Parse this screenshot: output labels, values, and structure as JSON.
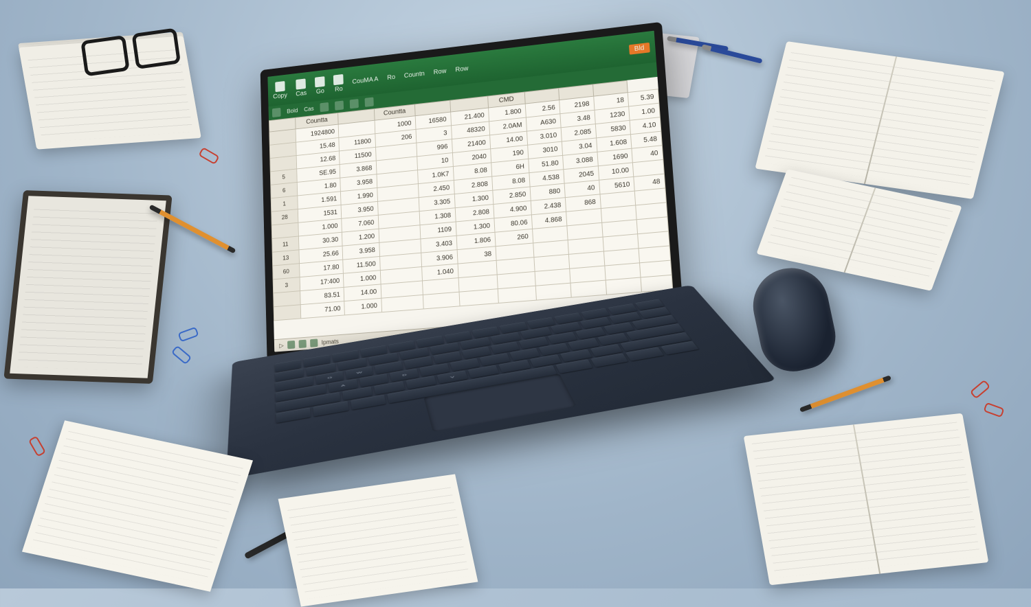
{
  "ribbon": {
    "items": [
      "Copy",
      "Cas",
      "Go",
      "Ro",
      "CouMA A",
      "Ro",
      "Countn",
      "Row",
      "Row"
    ],
    "right_badge": "Bld"
  },
  "toolbar": {
    "items": [
      "Bold",
      "Cas"
    ]
  },
  "headers": [
    "",
    "Countta",
    "",
    "Countta",
    "",
    "",
    "CMD",
    "",
    "",
    ""
  ],
  "row_labels": [
    "",
    "",
    "",
    "5",
    "6",
    "1",
    "28",
    "",
    "11",
    "13",
    "60",
    "3",
    "",
    ""
  ],
  "rows": [
    [
      "1924800",
      "",
      "1000",
      "16580",
      "21.400",
      "1.800",
      "2.56",
      "2198",
      "18",
      "5.39"
    ],
    [
      "15.48",
      "11800",
      "206",
      "3",
      "48320",
      "2.0AM",
      "A630",
      "3.48",
      "1230",
      "1.00"
    ],
    [
      "12.68",
      "11500",
      "",
      "996",
      "21400",
      "14.00",
      "3.010",
      "2.085",
      "5830",
      "4.10"
    ],
    [
      "SE.95",
      "3.868",
      "",
      "10",
      "2040",
      "190",
      "3010",
      "3.04",
      "1.608",
      "5.48"
    ],
    [
      "1.80",
      "3.958",
      "",
      "1.0K7",
      "8.08",
      "6H",
      "51.80",
      "3.088",
      "1690",
      "40"
    ],
    [
      "1.591",
      "1.990",
      "",
      "2.450",
      "2.808",
      "8.08",
      "4.538",
      "2045",
      "10.00",
      ""
    ],
    [
      "1531",
      "3.950",
      "",
      "3.305",
      "1.300",
      "2.850",
      "880",
      "40",
      "5610",
      "48"
    ],
    [
      "1.000",
      "7.060",
      "",
      "1.308",
      "2.808",
      "4.900",
      "2.438",
      "868",
      "",
      ""
    ],
    [
      "30.30",
      "1.200",
      "",
      "1109",
      "1.300",
      "80.06",
      "4.868",
      "",
      "",
      ""
    ],
    [
      "25.66",
      "3.958",
      "",
      "3.403",
      "1.806",
      "260",
      "",
      "",
      "",
      ""
    ],
    [
      "17.80",
      "11.500",
      "",
      "3.906",
      "38",
      "",
      "",
      "",
      "",
      ""
    ],
    [
      "17:400",
      "1.000",
      "",
      "1.040",
      "",
      "",
      "",
      "",
      "",
      ""
    ],
    [
      "83.51",
      "14.00",
      "",
      "",
      "",
      "",
      "",
      "",
      "",
      ""
    ],
    [
      "71.00",
      "1.000",
      "",
      "",
      "",
      "",
      "",
      "",
      "",
      ""
    ]
  ],
  "statusbar": {
    "text": "Ipmats"
  },
  "colors": {
    "ribbon_green": "#1e6330",
    "accent_orange": "#e57828"
  }
}
